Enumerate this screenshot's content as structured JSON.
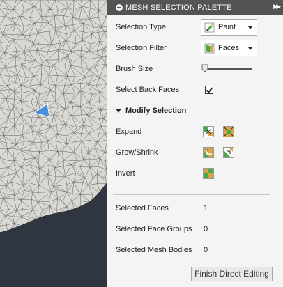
{
  "palette": {
    "title": "MESH SELECTION PALETTE",
    "selection_type": {
      "label": "Selection Type",
      "value": "Paint",
      "icon": "paint-brush-icon"
    },
    "selection_filter": {
      "label": "Selection Filter",
      "value": "Faces",
      "icon": "faces-filter-icon"
    },
    "brush_size": {
      "label": "Brush Size",
      "level": 0.0
    },
    "select_back_faces": {
      "label": "Select Back Faces",
      "checked": true
    },
    "modify_selection": {
      "title": "Modify Selection",
      "expand": {
        "label": "Expand"
      },
      "grow_shrink": {
        "label": "Grow/Shrink"
      },
      "invert": {
        "label": "Invert"
      }
    },
    "stats": {
      "faces": {
        "label": "Selected Faces",
        "value": "1"
      },
      "face_groups": {
        "label": "Selected Face Groups",
        "value": "0"
      },
      "mesh_bodies": {
        "label": "Selected Mesh Bodies",
        "value": "0"
      }
    },
    "finish_button": "Finish Direct Editing"
  },
  "colors": {
    "title_bar": "#545454",
    "panel_bg": "#f4f4f4",
    "mesh_fill": "#d9d8d2",
    "mesh_line": "#5e5e5e",
    "viewport_bg": "#2f3640",
    "selected_face": "#4a90d9",
    "icon_orange": "#d9a441",
    "icon_green": "#4aa84a"
  }
}
